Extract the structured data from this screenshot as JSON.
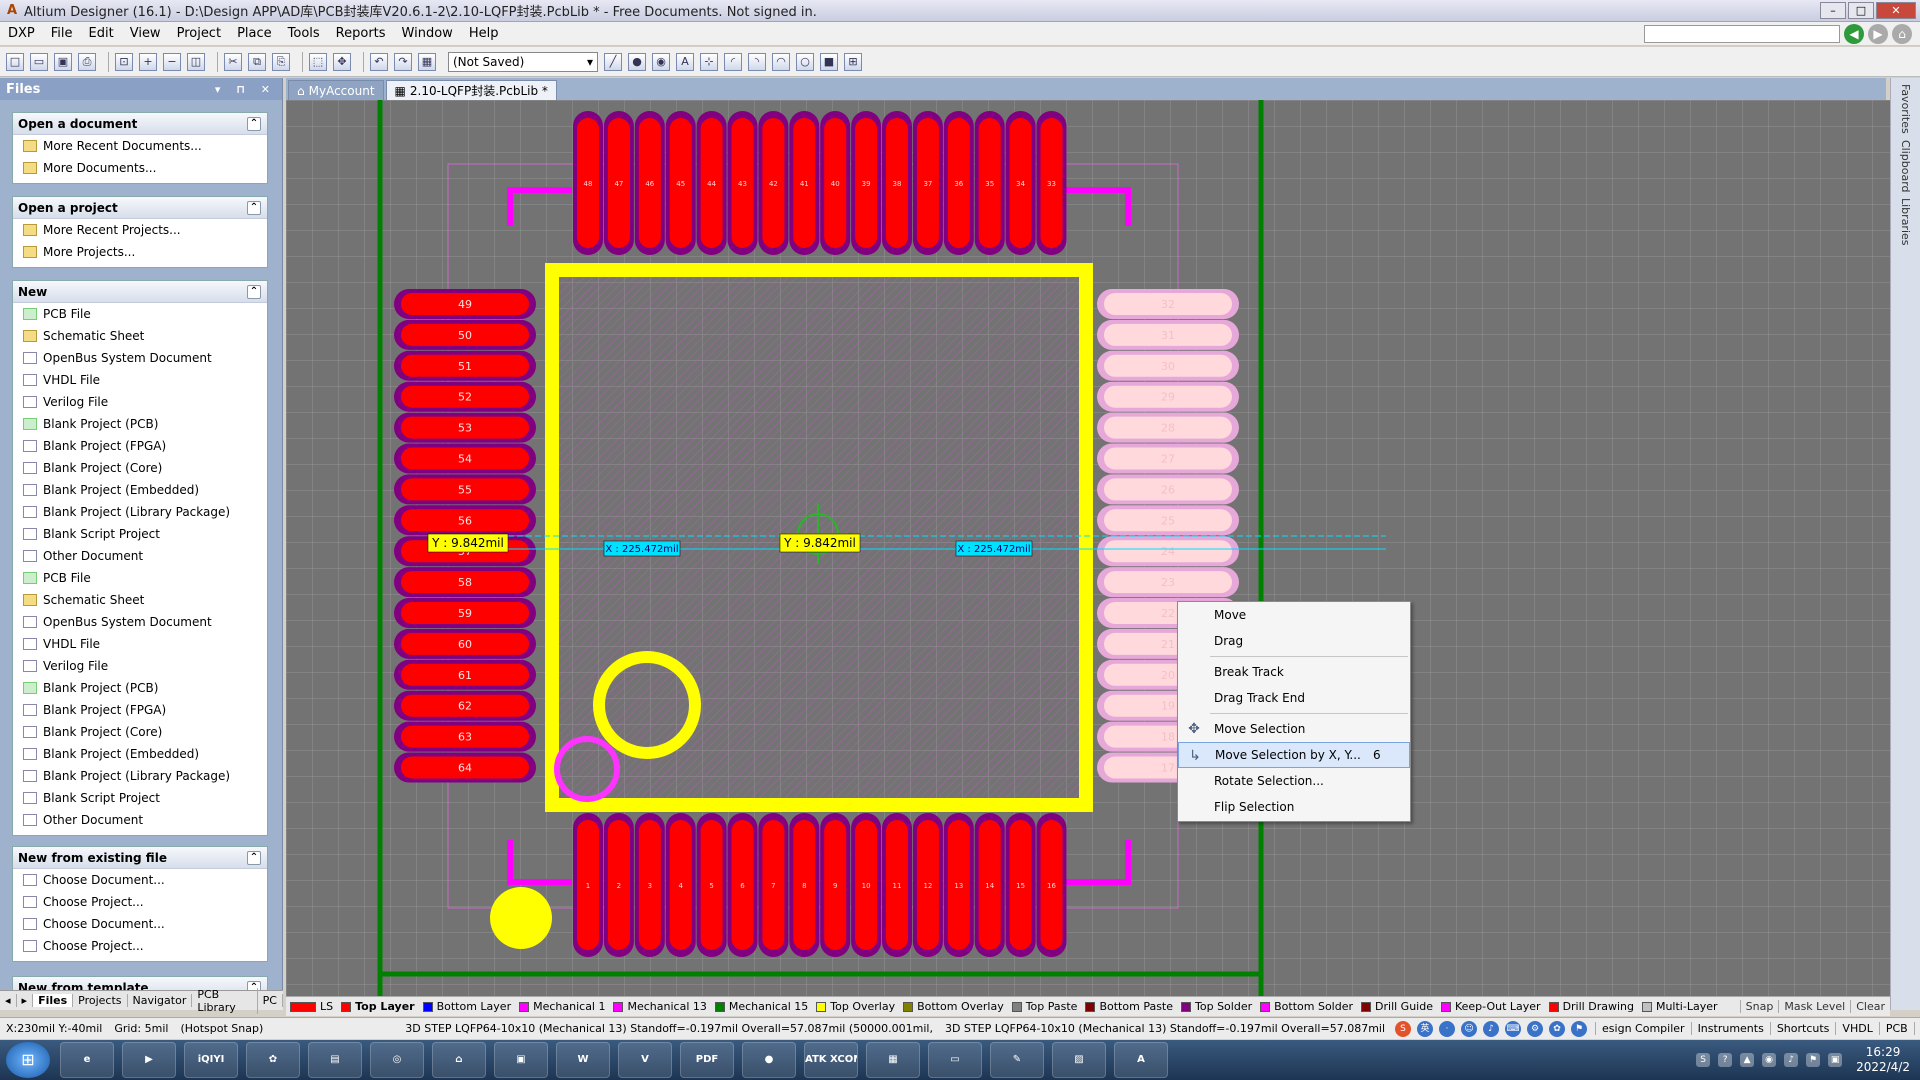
{
  "window": {
    "title": "Altium Designer (16.1) - D:\\Design APP\\AD库\\PCB封装库V20.6.1-2\\2.10-LQFP封装.PcbLib * - Free Documents. Not signed in.",
    "app_icon_glyph": "A",
    "minimize_glyph": "–",
    "maximize_glyph": "□",
    "close_glyph": "✕"
  },
  "menubar": {
    "items": [
      "DXP",
      "File",
      "Edit",
      "View",
      "Project",
      "Place",
      "Tools",
      "Reports",
      "Window",
      "Help"
    ],
    "back_glyph": "◀",
    "forward_glyph": "▶",
    "home_glyph": "⌂"
  },
  "toolbar": {
    "icons": [
      "new-icon",
      "open-icon",
      "save-icon",
      "print-icon",
      "zoom-fit-icon",
      "zoom-in-icon",
      "zoom-out-icon",
      "zoom-area-icon",
      "cut-icon",
      "copy-icon",
      "paste-icon",
      "select-icon",
      "move-icon",
      "undo-icon",
      "redo-icon",
      "grid-icon"
    ],
    "icon_glyphs": [
      "□",
      "▭",
      "▣",
      "⎙",
      "⊡",
      "+",
      "−",
      "◫",
      "✂",
      "⧉",
      "⎘",
      "⬚",
      "✥",
      "↶",
      "↷",
      "▦"
    ],
    "variant_value": "(Not Saved)",
    "variant_arrow": "▾",
    "draw_icons": [
      "line-icon",
      "pad-icon",
      "via-icon",
      "string-icon",
      "coordinate-icon",
      "arc-center-icon",
      "arc-edge-icon",
      "arc-any-icon",
      "circle-icon",
      "fill-icon",
      "array-icon"
    ],
    "draw_glyphs": [
      "╱",
      "●",
      "◉",
      "A",
      "⊹",
      "◜",
      "◝",
      "◠",
      "○",
      "■",
      "⊞"
    ]
  },
  "files_panel": {
    "title": "Files",
    "controls": "▾ ⊓ ✕",
    "collapse_glyph": "⌃",
    "sections": [
      {
        "title": "Open a document",
        "items": [
          {
            "label": "More Recent Documents...",
            "icon": "folder"
          },
          {
            "label": "More Documents...",
            "icon": "folder"
          }
        ]
      },
      {
        "title": "Open a project",
        "items": [
          {
            "label": "More Recent Projects...",
            "icon": "folder"
          },
          {
            "label": "More Projects...",
            "icon": "folder"
          }
        ]
      },
      {
        "title": "New",
        "items": [
          {
            "label": "PCB File",
            "icon": "pcb"
          },
          {
            "label": "Schematic Sheet",
            "icon": "folder"
          },
          {
            "label": "OpenBus System Document",
            "icon": "doc"
          },
          {
            "label": "VHDL File",
            "icon": "doc"
          },
          {
            "label": "Verilog File",
            "icon": "doc"
          },
          {
            "label": "Blank Project (PCB)",
            "icon": "pcb"
          },
          {
            "label": "Blank Project (FPGA)",
            "icon": "doc"
          },
          {
            "label": "Blank Project (Core)",
            "icon": "doc"
          },
          {
            "label": "Blank Project (Embedded)",
            "icon": "doc"
          },
          {
            "label": "Blank Project (Library Package)",
            "icon": "doc"
          },
          {
            "label": "Blank Script Project",
            "icon": "doc"
          },
          {
            "label": "Other Document",
            "icon": "doc"
          },
          {
            "label": "PCB File",
            "icon": "pcb"
          },
          {
            "label": "Schematic Sheet",
            "icon": "folder"
          },
          {
            "label": "OpenBus System Document",
            "icon": "doc"
          },
          {
            "label": "VHDL File",
            "icon": "doc"
          },
          {
            "label": "Verilog File",
            "icon": "doc"
          },
          {
            "label": "Blank Project (PCB)",
            "icon": "pcb"
          },
          {
            "label": "Blank Project (FPGA)",
            "icon": "doc"
          },
          {
            "label": "Blank Project (Core)",
            "icon": "doc"
          },
          {
            "label": "Blank Project (Embedded)",
            "icon": "doc"
          },
          {
            "label": "Blank Project (Library Package)",
            "icon": "doc"
          },
          {
            "label": "Blank Script Project",
            "icon": "doc"
          },
          {
            "label": "Other Document",
            "icon": "doc"
          }
        ]
      },
      {
        "title": "New from existing file",
        "items": [
          {
            "label": "Choose Document...",
            "icon": "doc"
          },
          {
            "label": "Choose Project...",
            "icon": "doc"
          },
          {
            "label": "Choose Document...",
            "icon": "doc"
          },
          {
            "label": "Choose Project...",
            "icon": "doc"
          }
        ]
      },
      {
        "title": "New from template",
        "items": []
      }
    ],
    "bottom_tabs": [
      "◂",
      "▸",
      "Files",
      "Projects",
      "Navigator",
      "PCB Library",
      "PC"
    ]
  },
  "doc_tabs": [
    {
      "label": "MyAccount",
      "icon": "home-icon",
      "glyph": "⌂"
    },
    {
      "label": "2.10-LQFP封装.PcbLib *",
      "icon": "pcb-doc-icon",
      "glyph": "▦"
    }
  ],
  "pcb": {
    "pins_left": [
      "49",
      "50",
      "51",
      "52",
      "53",
      "54",
      "55",
      "56",
      "57",
      "58",
      "59",
      "60",
      "61",
      "62",
      "63",
      "64"
    ],
    "pins_right": [
      "32",
      "31",
      "30",
      "29",
      "28",
      "27",
      "26",
      "25",
      "24",
      "23",
      "22",
      "21",
      "20",
      "19",
      "18",
      "17"
    ],
    "pins_top": [
      "48",
      "47",
      "46",
      "45",
      "44",
      "43",
      "42",
      "41",
      "40",
      "39",
      "38",
      "37",
      "36",
      "35",
      "34",
      "33"
    ],
    "pins_bottom": [
      "1",
      "2",
      "3",
      "4",
      "5",
      "6",
      "7",
      "8",
      "9",
      "10",
      "11",
      "12",
      "13",
      "14",
      "15",
      "16"
    ],
    "snap_tips": [
      {
        "label": "Y : 9.842mil",
        "style": "yellow"
      },
      {
        "label": "X : 225.472mil",
        "style": "cyan"
      },
      {
        "label": "Y : 9.842mil",
        "style": "yellow"
      },
      {
        "label": "X : 225.472mil",
        "style": "cyan"
      }
    ],
    "colors": {
      "top_layer": "#ff0000",
      "top_solder": "#800080",
      "overlay": "#ffff00",
      "mechanical": "#ff00ff",
      "board_line": "#008000"
    }
  },
  "right_strip": [
    "Favorites",
    "Clipboard",
    "Libraries"
  ],
  "layers": [
    {
      "label": "LS",
      "color": "#ff0000"
    },
    {
      "label": "Top Layer",
      "color": "#ff0000",
      "selected": true
    },
    {
      "label": "Bottom Layer",
      "color": "#0000ff"
    },
    {
      "label": "Mechanical 1",
      "color": "#ff00ff"
    },
    {
      "label": "Mechanical 13",
      "color": "#ff00ff"
    },
    {
      "label": "Mechanical 15",
      "color": "#008000"
    },
    {
      "label": "Top Overlay",
      "color": "#ffff00"
    },
    {
      "label": "Bottom Overlay",
      "color": "#808000"
    },
    {
      "label": "Top Paste",
      "color": "#808080"
    },
    {
      "label": "Bottom Paste",
      "color": "#800000"
    },
    {
      "label": "Top Solder",
      "color": "#800080"
    },
    {
      "label": "Bottom Solder",
      "color": "#ff00ff"
    },
    {
      "label": "Drill Guide",
      "color": "#800000"
    },
    {
      "label": "Keep-Out Layer",
      "color": "#ff00ff"
    },
    {
      "label": "Drill Drawing",
      "color": "#ff0000"
    },
    {
      "label": "Multi-Layer",
      "color": "#c0c0c0"
    }
  ],
  "layer_tail": [
    "Snap",
    "Mask Level",
    "Clear"
  ],
  "status": {
    "coords": "X:230mil Y:-40mil",
    "grid": "Grid: 5mil",
    "hotspot": "(Hotspot Snap)",
    "info1": "3D STEP LQFP64-10x10 (Mechanical 13)  Standoff=-0.197mil  Overall=57.087mil  (50000.001mil,",
    "info2": "3D STEP LQFP64-10x10 (Mechanical 13)  Standoff=-0.197mil  Overall=57.087mil",
    "ime_glyphs": [
      "S",
      "英",
      "·",
      "☺",
      "♪",
      "⌨",
      "⚙",
      "✿",
      "⚑"
    ],
    "panels": [
      "esign Compiler",
      "Instruments",
      "Shortcuts",
      "VHDL",
      "PCB",
      ">>"
    ]
  },
  "context_menu": {
    "items": [
      {
        "label": "Move",
        "icon": "",
        "shortcut": ""
      },
      {
        "label": "Drag",
        "icon": "",
        "shortcut": ""
      },
      {
        "sep": true
      },
      {
        "label": "Break Track",
        "icon": "",
        "shortcut": ""
      },
      {
        "label": "Drag Track End",
        "icon": "",
        "shortcut": ""
      },
      {
        "sep": true
      },
      {
        "label": "Move Selection",
        "icon": "move-icon",
        "glyph": "✥",
        "shortcut": ""
      },
      {
        "label": "Move Selection by X, Y...",
        "icon": "move-xy-icon",
        "glyph": "↳",
        "shortcut": "6",
        "highlight": true
      },
      {
        "label": "Rotate Selection...",
        "icon": "",
        "shortcut": ""
      },
      {
        "label": "Flip Selection",
        "icon": "",
        "shortcut": ""
      }
    ]
  },
  "taskbar": {
    "start_glyph": "⊞",
    "apps": [
      {
        "name": "ie",
        "label": "e"
      },
      {
        "name": "media",
        "label": "▶"
      },
      {
        "name": "iqiyi",
        "label": "iQIYI"
      },
      {
        "name": "photos",
        "label": "✿"
      },
      {
        "name": "explorer",
        "label": "▤"
      },
      {
        "name": "chrome",
        "label": "◎"
      },
      {
        "name": "network",
        "label": "⌂"
      },
      {
        "name": "terminal",
        "label": "▣"
      },
      {
        "name": "word",
        "label": "W"
      },
      {
        "name": "visio",
        "label": "V"
      },
      {
        "name": "pdf",
        "label": "PDF"
      },
      {
        "name": "globe",
        "label": "●"
      },
      {
        "name": "atk-xcom",
        "label": "ATK XCOM"
      },
      {
        "name": "calc",
        "label": "▦"
      },
      {
        "name": "screen",
        "label": "▭"
      },
      {
        "name": "paint",
        "label": "✎"
      },
      {
        "name": "remote",
        "label": "▨"
      },
      {
        "name": "altium",
        "label": "A"
      }
    ],
    "tray_icons": [
      "S",
      "?",
      "▲",
      "◉",
      "♪",
      "⚑",
      "▣"
    ],
    "time": "16:29",
    "date": "2022/4/2"
  }
}
